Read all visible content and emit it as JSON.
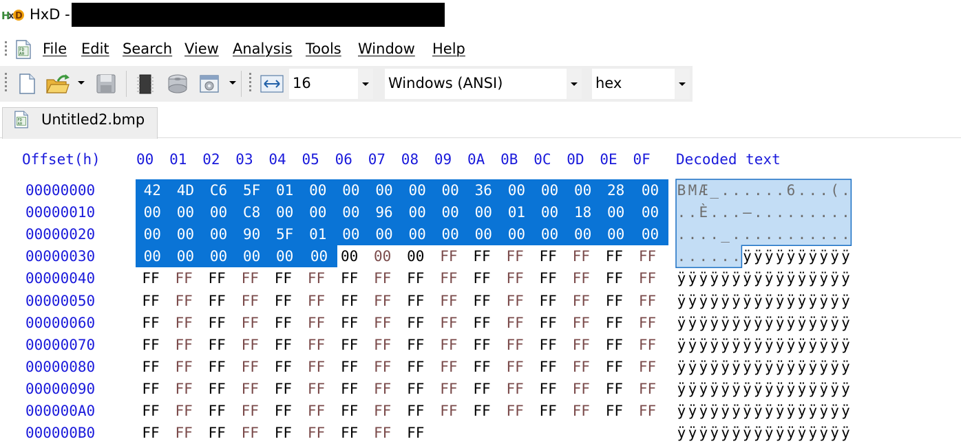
{
  "window": {
    "title": "HxD - "
  },
  "menu": [
    {
      "id": "file",
      "label": "File"
    },
    {
      "id": "edit",
      "label": "Edit"
    },
    {
      "id": "search",
      "label": "Search"
    },
    {
      "id": "view",
      "label": "View"
    },
    {
      "id": "analysis",
      "label": "Analysis"
    },
    {
      "id": "tools",
      "label": "Tools"
    },
    {
      "id": "window",
      "label": "Window"
    },
    {
      "id": "help",
      "label": "Help"
    }
  ],
  "toolbar": {
    "bytes_per_row": "16",
    "charset": "Windows (ANSI)",
    "offset_base": "hex"
  },
  "tab": {
    "label": "Untitled2.bmp"
  },
  "hexview": {
    "offset_header": "Offset(h)",
    "column_headers": [
      "00",
      "01",
      "02",
      "03",
      "04",
      "05",
      "06",
      "07",
      "08",
      "09",
      "0A",
      "0B",
      "0C",
      "0D",
      "0E",
      "0F"
    ],
    "text_header": "Decoded text",
    "offsets": [
      "00000000",
      "00000010",
      "00000020",
      "00000030",
      "00000040",
      "00000050",
      "00000060",
      "00000070",
      "00000080",
      "00000090",
      "000000A0",
      "000000B0"
    ],
    "bytes_hex": "424DC65F010000000000360000002800000000C8000000960000000100180000000000905F0100000000000000000000000000000000000000FFFFFFFFFFFFFFFFFFFFFFFFFFFFFFFFFFFFFFFFFFFFFFFFFFFFFFFFFFFFFFFFFFFFFFFFFFFFFFFFFFFFFFFFFFFFFFFFFFFFFFFFFFFFFFFFFFFFFFFFFFFFFFFFFFFFFFFFFFFFFFFFFFFFFFFFFFFFFFFFFFFFFFFFFFFFFFFFFFFFFFFFFFFFFFFFFFFFFFFFFFFFFFFFFFFFFFFFFFFFFFFFFFFFFFFFFFFFFFFFFFFFFFFFFFFFFFFF",
    "decoded_rows": [
      "BMÆ_......6...(.",
      "..È...–.........",
      "...._...........",
      "......ÿÿÿÿÿÿÿÿÿÿ",
      "ÿÿÿÿÿÿÿÿÿÿÿÿÿÿÿÿ",
      "ÿÿÿÿÿÿÿÿÿÿÿÿÿÿÿÿ",
      "ÿÿÿÿÿÿÿÿÿÿÿÿÿÿÿÿ",
      "ÿÿÿÿÿÿÿÿÿÿÿÿÿÿÿÿ",
      "ÿÿÿÿÿÿÿÿÿÿÿÿÿÿÿÿ",
      "ÿÿÿÿÿÿÿÿÿÿÿÿÿÿÿÿ",
      "ÿÿÿÿÿÿÿÿÿÿÿÿÿÿÿÿ",
      "ÿÿÿÿÿÿÿÿÿÿÿÿÿÿÿÿ"
    ],
    "selection_length": 54,
    "selection_color": "#0a74d6",
    "text_selection_color": "#c3ddf5"
  }
}
